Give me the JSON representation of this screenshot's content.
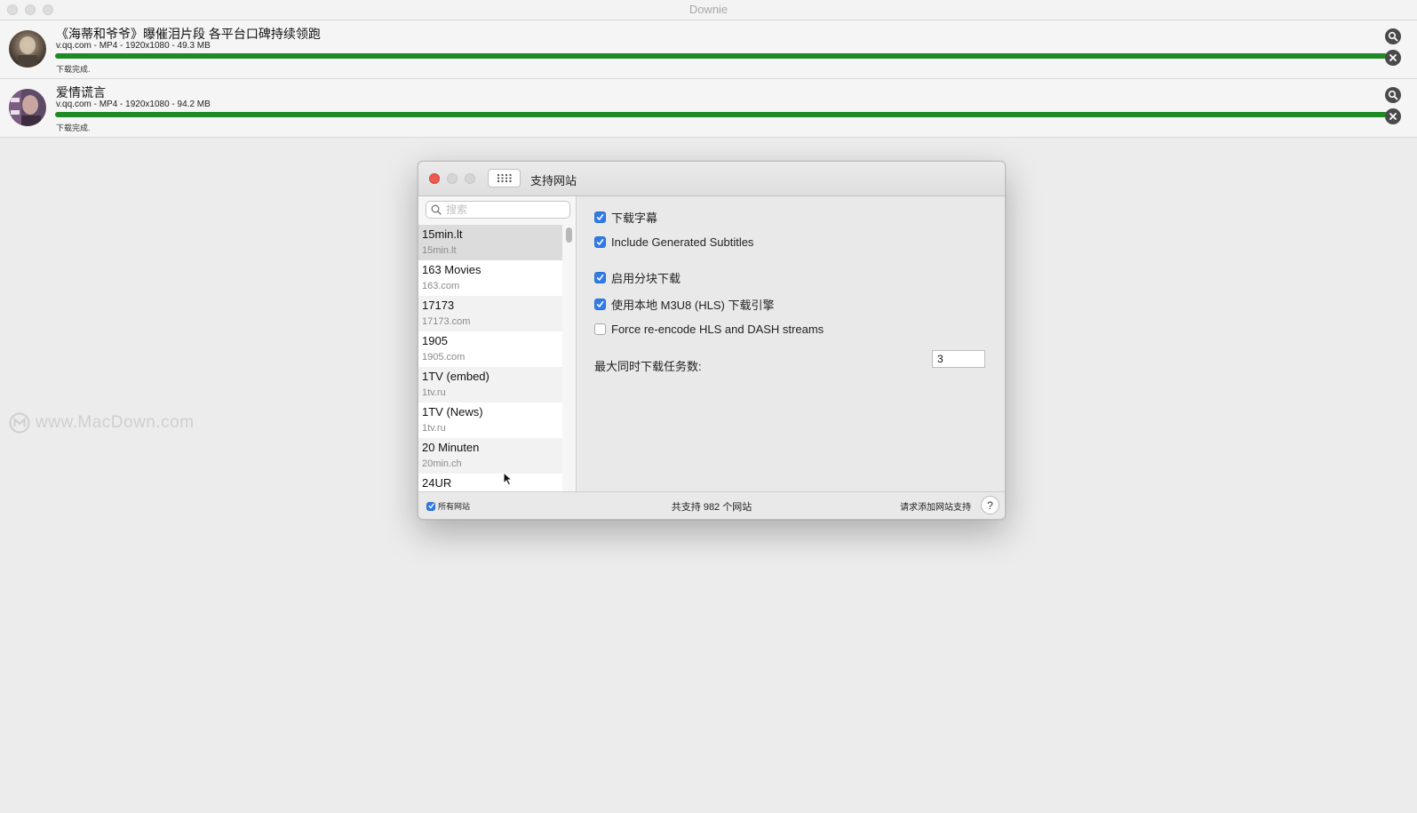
{
  "app": {
    "title": "Downie"
  },
  "downloads": [
    {
      "title": "《海蒂和爷爷》曝催泪片段 各平台口碑持续领跑",
      "meta": "v.qq.com - MP4 - 1920x1080 - 49.3 MB",
      "status": "下载完成.",
      "progress": 1.0
    },
    {
      "title": "爱情谎言",
      "meta": "v.qq.com - MP4 - 1920x1080 - 94.2 MB",
      "status": "下载完成.",
      "progress": 1.0
    }
  ],
  "watermark": "www.MacDown.com",
  "dialog": {
    "title": "支持网站",
    "search_placeholder": "搜索",
    "sites": [
      {
        "name": "15min.lt",
        "domain": "15min.lt"
      },
      {
        "name": "163 Movies",
        "domain": "163.com"
      },
      {
        "name": "17173",
        "domain": "17173.com"
      },
      {
        "name": "1905",
        "domain": "1905.com"
      },
      {
        "name": "1TV (embed)",
        "domain": "1tv.ru"
      },
      {
        "name": "1TV (News)",
        "domain": "1tv.ru"
      },
      {
        "name": "20 Minuten",
        "domain": "20min.ch"
      },
      {
        "name": "24UR",
        "domain": ""
      }
    ],
    "options": {
      "download_subtitles": {
        "label": "下载字幕",
        "checked": true
      },
      "generated_subtitles": {
        "label": "Include Generated Subtitles",
        "checked": true
      },
      "chunked_download": {
        "label": "启用分块下载",
        "checked": true
      },
      "native_hls": {
        "label": "使用本地 M3U8 (HLS) 下载引擎",
        "checked": true
      },
      "force_reencode": {
        "label": "Force re-encode HLS and DASH streams",
        "checked": false
      }
    },
    "max_concurrent_label": "最大同时下载任务数:",
    "max_concurrent_value": "3",
    "footer": {
      "all_sites_label": "所有网站",
      "all_sites_checked": true,
      "count_text": "共支持 982 个网站",
      "request_label": "请求添加网站支持",
      "help_label": "?"
    }
  },
  "colors": {
    "progress": "#1f8a25",
    "checkbox": "#2f7be8",
    "close_dot": "#ee5a52"
  }
}
